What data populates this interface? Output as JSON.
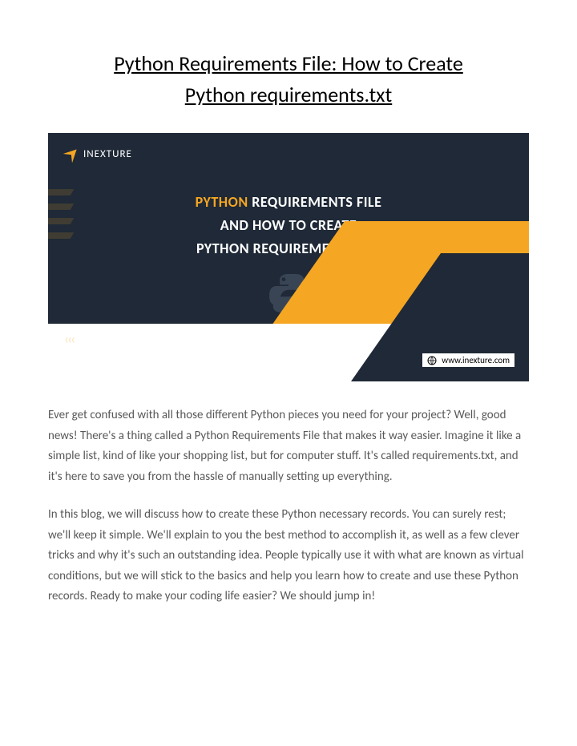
{
  "title_line1": "Python Requirements File: How to Create",
  "title_line2": "Python requirements.txt",
  "banner": {
    "logo_text": "INEXTURE",
    "headline_accent": "PYTHON",
    "headline_rest1": " REQUIREMENTS FILE",
    "headline_line2": "AND HOW TO CREATE",
    "headline_line3": "PYTHON REQUIREMENTS.TXT",
    "url": "www.inexture.com"
  },
  "paragraphs": {
    "p1": "Ever get confused with all those different Python pieces you need for your project? Well, good news! There's a thing called a Python Requirements File that makes it way easier. Imagine it like a simple list, kind of like your shopping list, but for computer stuff. It's called requirements.txt, and it's here to save you from the hassle of manually setting up everything.",
    "p2": "In this blog, we will discuss how to create these Python necessary records. You can surely rest; we'll keep it simple. We'll explain to you the best method to accomplish it, as well as a few clever tricks and why it's such an outstanding idea. People typically use it with what are known as virtual conditions, but we will stick to the basics and help you learn how to create and use these Python records. Ready to make your coding life easier? We should jump in!"
  }
}
